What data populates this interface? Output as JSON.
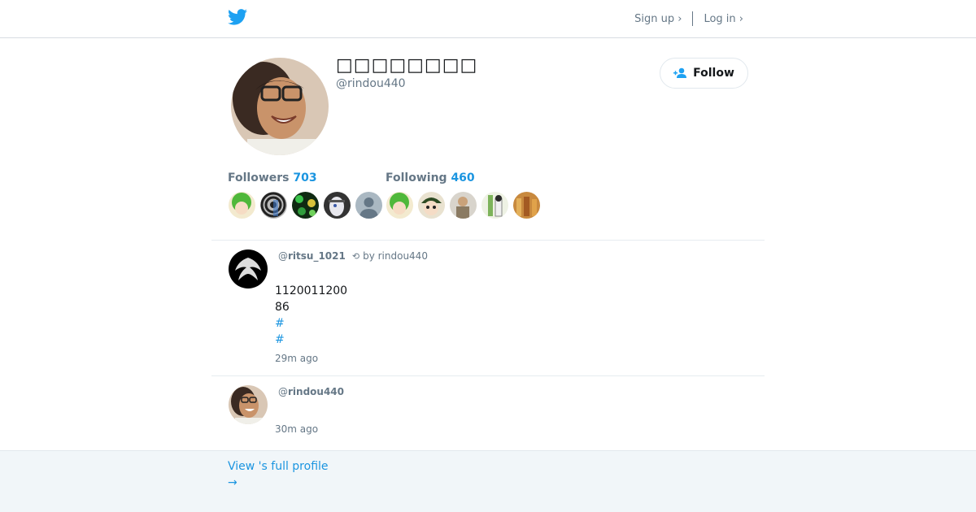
{
  "nav": {
    "signup_label": "Sign up ›",
    "login_label": "Log in ›",
    "brand_icon": "twitter-bird-icon",
    "brand_color": "#1da1f2"
  },
  "profile": {
    "name": "□□□□□□□□",
    "handle": "@rindou440",
    "follow_label": "Follow",
    "followers_label": "Followers",
    "followers_count": "703",
    "following_label": "Following",
    "following_count": "460"
  },
  "tweets": [
    {
      "handle_prefix": "@",
      "handle": "ritsu_1021",
      "retweet_by": "by rindou440",
      "lines": [
        "1120011200",
        "86",
        "#",
        "#"
      ],
      "time": "29m ago"
    },
    {
      "handle_prefix": "@",
      "handle": "rindou440",
      "time": "30m ago"
    }
  ],
  "footer": {
    "view_profile": "View 's full profile",
    "arrow": "→"
  },
  "colors": {
    "accent": "#1b95e0",
    "muted": "#657786",
    "footer_bg": "#f1f6f9"
  }
}
